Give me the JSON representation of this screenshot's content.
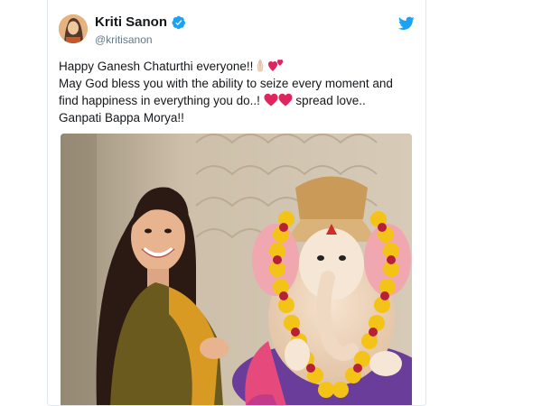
{
  "tweet": {
    "author_name": "Kriti Sanon",
    "author_handle": "@kritisanon",
    "lines": [
      "Happy Ganesh Chaturthi everyone!!",
      "May God bless you with the ability to seize every moment and",
      "find happiness in everything you do..!",
      " spread love..",
      "Ganpati Bappa Morya!!"
    ]
  },
  "icons": {
    "verified": "verified-badge-icon",
    "platform": "twitter-bird-icon",
    "emoji_pray": "folded-hands-emoji",
    "emoji_hearts": "two-hearts-emoji",
    "emoji_red_heart": "red-heart-emoji"
  },
  "colors": {
    "verified": "#1da1f2",
    "platform": "#1da1f2",
    "heart": "#e0245e",
    "text": "#14171a",
    "handle": "#657786"
  }
}
